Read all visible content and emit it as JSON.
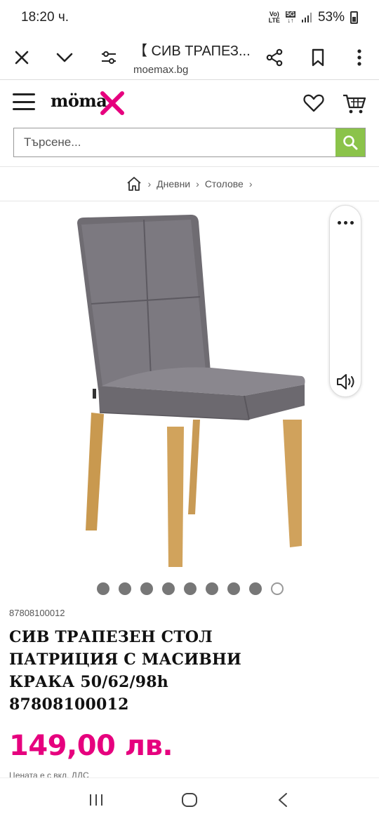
{
  "status_bar": {
    "time": "18:20 ч.",
    "network_top": "Vo)",
    "network_bottom": "LTE",
    "net_5g": "5G",
    "battery": "53%"
  },
  "browser": {
    "tab_title": "【 СИВ ТРАПЕЗ...",
    "url": "moemax.bg"
  },
  "site": {
    "logo_text": "möma",
    "brand_color": "#e6007e"
  },
  "search": {
    "placeholder": "Търсене..."
  },
  "breadcrumb": {
    "items": [
      "Дневни",
      "Столове"
    ]
  },
  "carousel": {
    "total": 9,
    "active_index": 8
  },
  "product": {
    "sku": "87808100012",
    "title": "СИВ ТРАПЕЗЕН СТОЛ ПАТРИЦИЯ С МАСИВНИ КРАКА 50/62/98h 87808100012",
    "price": "149,00 лв.",
    "vat_note": "Цената е с вкл. ДДС"
  }
}
